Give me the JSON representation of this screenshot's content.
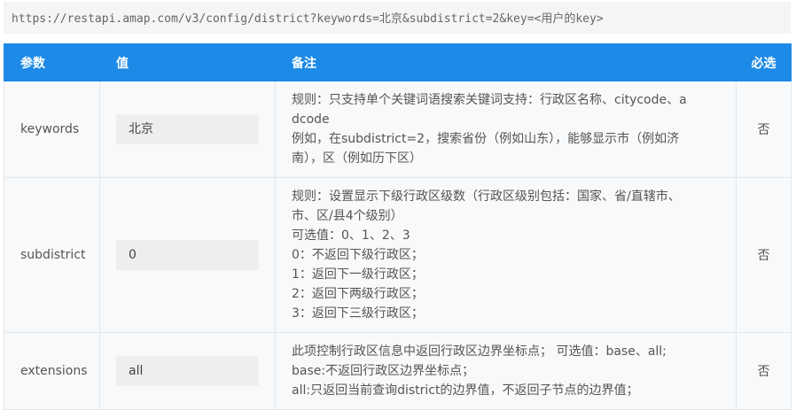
{
  "url": "https://restapi.amap.com/v3/config/district?keywords=北京&subdistrict=2&key=<用户的key>",
  "table": {
    "headers": {
      "param": "参数",
      "value": "值",
      "remark": "备注",
      "required": "必选"
    },
    "rows": [
      {
        "param": "keywords",
        "value": "北京",
        "remark": [
          "规则：只支持单个关键词语搜索关键词支持：行政区名称、citycode、a",
          "dcode",
          "例如，在subdistrict=2，搜索省份（例如山东），能够显示市（例如济",
          "南），区（例如历下区）"
        ],
        "required": "否"
      },
      {
        "param": "subdistrict",
        "value": "0",
        "remark": [
          "规则：设置显示下级行政区级数（行政区级别包括：国家、省/直辖市、",
          "市、区/县4个级别）",
          "可选值：0、1、2、3",
          "0：不返回下级行政区；",
          "1：返回下一级行政区；",
          "2：返回下两级行政区；",
          "3：返回下三级行政区；"
        ],
        "required": "否"
      },
      {
        "param": "extensions",
        "value": "all",
        "remark": [
          "此项控制行政区信息中返回行政区边界坐标点； 可选值：base、all;",
          "base:不返回行政区边界坐标点；",
          "all:只返回当前查询district的边界值，不返回子节点的边界值；"
        ],
        "required": "否"
      }
    ]
  },
  "colors": {
    "header_bg": "#1c8ae6",
    "row_bg": "#f7f9fb",
    "value_box": "#edeef0"
  }
}
